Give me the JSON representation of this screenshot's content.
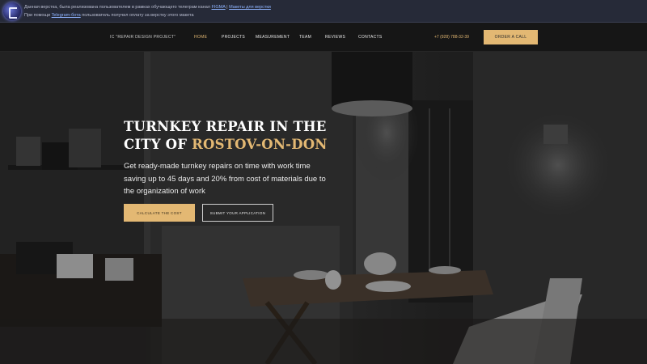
{
  "notice": {
    "line1_text": "Данная верстка, была реализована пользователем в рамках обучающего телеграм канал",
    "line1_link1": "FIGMA",
    "line1_separator": " | ",
    "line1_link2": "Макеты для верстки",
    "line2_prefix": "При помощи",
    "line2_link": "Telegram-бота",
    "line2_suffix": "пользователь получил оплату за верстку этого макета"
  },
  "header": {
    "brand": "IC \"REPAIR DESIGN PROJECT\"",
    "nav": {
      "home": "HOME",
      "projects": "PROJECTS",
      "measurement": "MEASUREMENT",
      "team": "TEAM",
      "reviews": "REVIEWS",
      "contacts": "CONTACTS"
    },
    "phone": "+7 (928) 788-32-39",
    "call_button": "ORDER A CALL"
  },
  "hero": {
    "title_line1": "TURNKEY REPAIR IN THE",
    "title_line2_prefix": "CITY OF",
    "title_line2_accent": "ROSTOV-ON-DON",
    "subtitle": "Get ready-made turnkey repairs on time with work time saving up to 45 days and 20% from cost of materials due to the organization of work",
    "primary_button": "CALCULATE THE COST",
    "secondary_button": "SUBMIT YOUR APPLICATION"
  },
  "colors": {
    "accent": "#e3b873",
    "notice_bg": "#262a38",
    "header_bg": "#161616"
  }
}
